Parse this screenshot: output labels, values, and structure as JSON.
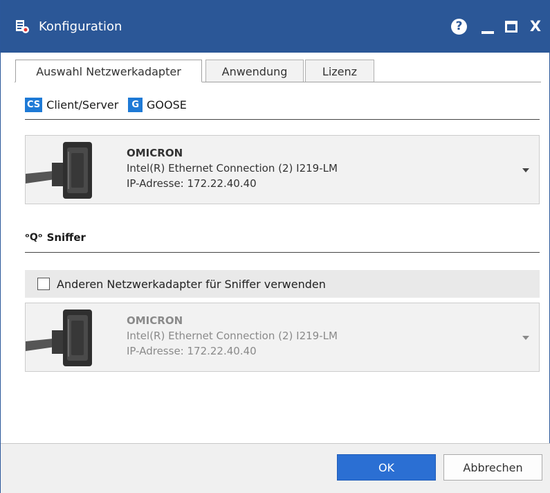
{
  "window": {
    "title": "Konfiguration",
    "help_glyph": "?",
    "close_glyph": "X",
    "title_color": "#2b5797"
  },
  "tabs": [
    {
      "label": "Auswahl Netzwerkadapter",
      "active": true
    },
    {
      "label": "Anwendung",
      "active": false
    },
    {
      "label": "Lizenz",
      "active": false
    }
  ],
  "client_server": {
    "cs_badge": "CS",
    "cs_label": "Client/Server",
    "g_badge": "G",
    "g_label": "GOOSE",
    "badge_color": "#1e7ad6"
  },
  "adapter_primary": {
    "name": "OMICRON",
    "description": "Intel(R) Ethernet Connection (2) I219-LM",
    "ip": "IP-Adresse: 172.22.40.40"
  },
  "sniffer": {
    "icon_glyph": "ᵒQᵒ",
    "label": "Sniffer",
    "checkbox_label": "Anderen Netzwerkadapter für Sniffer verwenden",
    "checkbox_checked": false
  },
  "adapter_sniffer": {
    "name": "OMICRON",
    "description": "Intel(R) Ethernet Connection (2) I219-LM",
    "ip": "IP-Adresse: 172.22.40.40",
    "disabled": true
  },
  "footer": {
    "ok_label": "OK",
    "cancel_label": "Abbrechen",
    "ok_color": "#2b6fd3"
  }
}
